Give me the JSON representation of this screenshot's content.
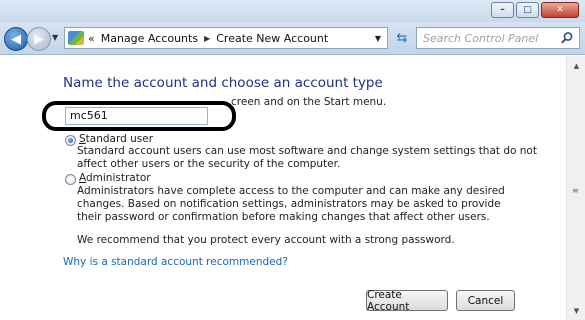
{
  "window": {
    "controls": {
      "minimize": "–",
      "maximize": "□",
      "close": "✕"
    }
  },
  "nav": {
    "back_icon": "back-arrow-icon",
    "forward_icon": "forward-arrow-icon",
    "breadcrumb_overflow": "«",
    "breadcrumbs": [
      "Manage Accounts",
      "Create New Account"
    ],
    "search_placeholder": "Search Control Panel"
  },
  "form": {
    "heading": "Name the account and choose an account type",
    "instruction_tail": "creen and on the Start menu.",
    "account_name": "mc561",
    "options": [
      {
        "label_access_key": "S",
        "label_rest": "tandard user",
        "checked": true,
        "description": "Standard account users can use most software and change system settings that do not affect other users or the security of the computer."
      },
      {
        "label_access_key": "A",
        "label_rest": "dministrator",
        "checked": false,
        "description": "Administrators have complete access to the computer and can make any desired changes. Based on notification settings, administrators may be asked to provide their password or confirmation before making changes that affect other users."
      }
    ],
    "recommendation": "We recommend that you protect every account with a strong password.",
    "why_link": "Why is a standard account recommended?",
    "create_button": "Create Account",
    "cancel_button": "Cancel"
  },
  "colors": {
    "heading": "#1e3287",
    "link": "#1566c4",
    "highlight_ring": "#000000"
  }
}
